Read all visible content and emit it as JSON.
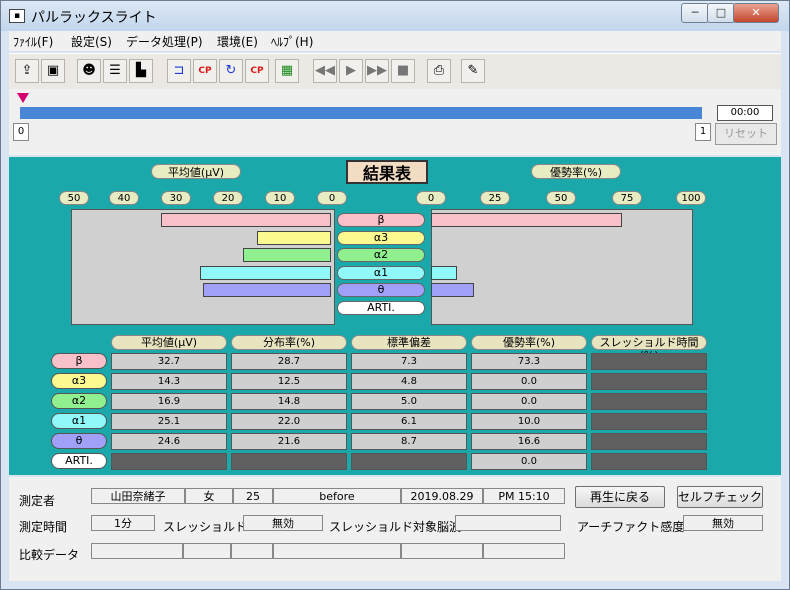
{
  "window": {
    "title": "パルラックスライト",
    "app_icon": "window-icon"
  },
  "menu": [
    {
      "label": "ﾌｧｲﾙ(F)"
    },
    {
      "label": "設定(S)"
    },
    {
      "label": "データ処理(P)"
    },
    {
      "label": "環境(E)"
    },
    {
      "label": "ﾍﾙﾌﾟ(H)"
    }
  ],
  "toolbar": {
    "icons": [
      "folder-open-icon",
      "save-icon",
      "user-icon",
      "record-icon",
      "chart-icon",
      "filter-icon",
      "cp-red-icon",
      "refresh-icon",
      "cp-refresh-icon",
      "device-icon",
      "rewind-icon",
      "play-icon",
      "fast-forward-icon",
      "stop-icon",
      "print-icon",
      "pen-icon"
    ],
    "cp_text": "CP"
  },
  "timeline": {
    "time": "00:00",
    "left_index": "0",
    "right_index": "1",
    "reset_label": "リセット"
  },
  "results": {
    "title": "結果表",
    "avg_header": "平均値(μV)",
    "dom_header": "優勢率(%)",
    "avg_ticks": [
      "50",
      "40",
      "30",
      "20",
      "10",
      "0"
    ],
    "dom_ticks": [
      "0",
      "25",
      "50",
      "75",
      "100"
    ],
    "bands": [
      {
        "label": "β",
        "color": "#f8c0c8",
        "avg": 32.7,
        "dom": 73.3
      },
      {
        "label": "α3",
        "color": "#fafa90",
        "avg": 14.3,
        "dom": 0.0
      },
      {
        "label": "α2",
        "color": "#90f090",
        "avg": 16.9,
        "dom": 0.0
      },
      {
        "label": "α1",
        "color": "#90f8f8",
        "avg": 25.1,
        "dom": 10.0
      },
      {
        "label": "θ",
        "color": "#a0a0f8",
        "avg": 24.6,
        "dom": 16.6
      },
      {
        "label": "ARTI.",
        "color": "#ffffff",
        "avg": 0,
        "dom": 0
      }
    ]
  },
  "table": {
    "headers": [
      "平均値(μV)",
      "分布率(%)",
      "標準偏差",
      "優勢率(%)",
      "スレッショルド時間(%)"
    ],
    "rows": [
      [
        "32.7",
        "28.7",
        "7.3",
        "73.3",
        ""
      ],
      [
        "14.3",
        "12.5",
        "4.8",
        "0.0",
        ""
      ],
      [
        "16.9",
        "14.8",
        "5.0",
        "0.0",
        ""
      ],
      [
        "25.1",
        "22.0",
        "6.1",
        "10.0",
        ""
      ],
      [
        "24.6",
        "21.6",
        "8.7",
        "16.6",
        ""
      ],
      [
        "",
        "",
        "",
        "0.0",
        ""
      ]
    ]
  },
  "info": {
    "measurer_label": "測定者",
    "name": "山田奈緒子",
    "sex": "女",
    "age": "25",
    "condition": "before",
    "date": "2019.08.29",
    "time": "PM 15:10",
    "measure_time_label": "測定時間",
    "measure_time": "1分",
    "threshold_label": "スレッショルド",
    "threshold_value": "無効",
    "threshold_target_label": "スレッショルド対象脳波",
    "threshold_target": "",
    "artifact_label": "アーチファクト感度",
    "artifact_value": "無効",
    "compare_label": "比較データ",
    "back_button": "再生に戻る",
    "selfcheck_button": "セルフチェック"
  }
}
